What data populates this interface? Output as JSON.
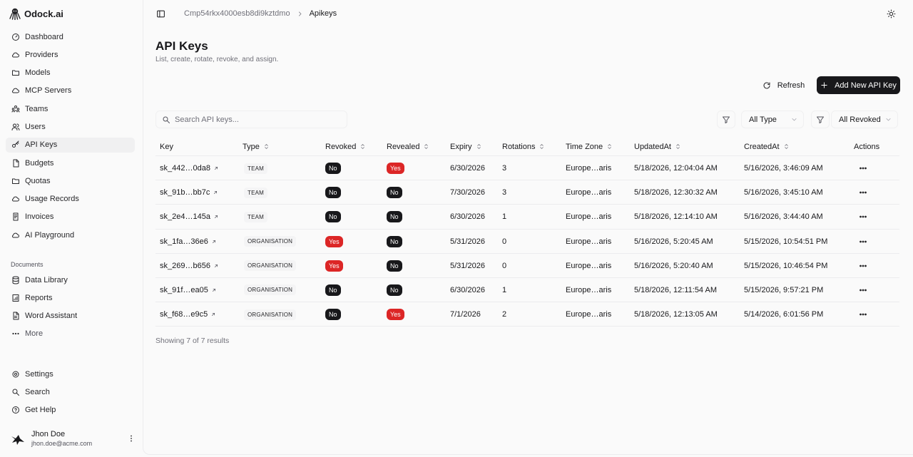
{
  "brand": {
    "name": "Odock.ai"
  },
  "sidebar": {
    "items": [
      {
        "label": "Dashboard",
        "icon": "dashboard-icon"
      },
      {
        "label": "Providers",
        "icon": "cloud-icon"
      },
      {
        "label": "Models",
        "icon": "folder-icon"
      },
      {
        "label": "MCP Servers",
        "icon": "cloud-icon"
      },
      {
        "label": "Teams",
        "icon": "teams-icon"
      },
      {
        "label": "Users",
        "icon": "users-icon"
      },
      {
        "label": "API Keys",
        "icon": "key-icon",
        "active": true
      },
      {
        "label": "Budgets",
        "icon": "file-icon"
      },
      {
        "label": "Quotas",
        "icon": "folder-icon"
      },
      {
        "label": "Usage Records",
        "icon": "cloud-icon"
      },
      {
        "label": "Invoices",
        "icon": "invoice-icon"
      },
      {
        "label": "AI Playground",
        "icon": "cloud-icon"
      }
    ],
    "documents_label": "Documents",
    "documents": [
      {
        "label": "Data Library",
        "icon": "database-icon"
      },
      {
        "label": "Reports",
        "icon": "report-icon"
      },
      {
        "label": "Word Assistant",
        "icon": "file-icon"
      },
      {
        "label": "More",
        "icon": "more-icon"
      }
    ],
    "bottom": [
      {
        "label": "Settings",
        "icon": "settings-icon"
      },
      {
        "label": "Search",
        "icon": "search-icon"
      },
      {
        "label": "Get Help",
        "icon": "help-icon"
      }
    ],
    "user": {
      "name": "Jhon Doe",
      "email": "jhon.doe@acme.com"
    }
  },
  "breadcrumb": {
    "parent": "Cmp54rkx4000esb8di9kztdmo",
    "current": "Apikeys"
  },
  "page": {
    "title": "API Keys",
    "subtitle": "List, create, rotate, revoke, and assign."
  },
  "toolbar": {
    "refresh_label": "Refresh",
    "add_label": "Add New API Key"
  },
  "search": {
    "placeholder": "Search API keys...",
    "value": ""
  },
  "filters": {
    "type_value": "All Type",
    "revoked_value": "All Revoked"
  },
  "table": {
    "headers": [
      "Key",
      "Type",
      "Revoked",
      "Revealed",
      "Expiry",
      "Rotations",
      "Time Zone",
      "UpdatedAt",
      "CreatedAt",
      "Actions"
    ],
    "rows": [
      {
        "key": "sk_442…0da8",
        "type": "TEAM",
        "revoked": "No",
        "revealed": "Yes",
        "expiry": "6/30/2026",
        "rotations": "3",
        "tz": "Europe…aris",
        "updated": "5/18/2026, 12:04:04 AM",
        "created": "5/16/2026, 3:46:09 AM"
      },
      {
        "key": "sk_91b…bb7c",
        "type": "TEAM",
        "revoked": "No",
        "revealed": "No",
        "expiry": "7/30/2026",
        "rotations": "3",
        "tz": "Europe…aris",
        "updated": "5/18/2026, 12:30:32 AM",
        "created": "5/16/2026, 3:45:10 AM"
      },
      {
        "key": "sk_2e4…145a",
        "type": "TEAM",
        "revoked": "No",
        "revealed": "No",
        "expiry": "6/30/2026",
        "rotations": "1",
        "tz": "Europe…aris",
        "updated": "5/18/2026, 12:14:10 AM",
        "created": "5/16/2026, 3:44:40 AM"
      },
      {
        "key": "sk_1fa…36e6",
        "type": "ORGANISATION",
        "revoked": "Yes",
        "revealed": "No",
        "expiry": "5/31/2026",
        "rotations": "0",
        "tz": "Europe…aris",
        "updated": "5/16/2026, 5:20:45 AM",
        "created": "5/15/2026, 10:54:51 PM"
      },
      {
        "key": "sk_269…b656",
        "type": "ORGANISATION",
        "revoked": "Yes",
        "revealed": "No",
        "expiry": "5/31/2026",
        "rotations": "0",
        "tz": "Europe…aris",
        "updated": "5/16/2026, 5:20:40 AM",
        "created": "5/15/2026, 10:46:54 PM"
      },
      {
        "key": "sk_91f…ea05",
        "type": "ORGANISATION",
        "revoked": "No",
        "revealed": "No",
        "expiry": "6/30/2026",
        "rotations": "1",
        "tz": "Europe…aris",
        "updated": "5/18/2026, 12:11:54 AM",
        "created": "5/15/2026, 9:57:21 PM"
      },
      {
        "key": "sk_f68…e9c5",
        "type": "ORGANISATION",
        "revoked": "No",
        "revealed": "Yes",
        "expiry": "7/1/2026",
        "rotations": "2",
        "tz": "Europe…aris",
        "updated": "5/18/2026, 12:13:05 AM",
        "created": "5/14/2026, 6:01:56 PM"
      }
    ]
  },
  "footer": {
    "results_text": "Showing 7 of 7 results"
  },
  "colors": {
    "accent": "#18181b",
    "yes_badge": "#dc2626",
    "no_badge": "#18181b",
    "background": "#fafafa"
  }
}
